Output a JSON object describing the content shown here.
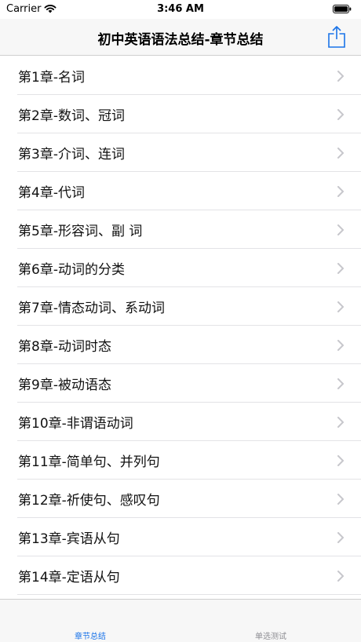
{
  "status_bar": {
    "carrier": "Carrier",
    "time": "3:46 AM",
    "wifi_icon": "wifi-icon",
    "battery_icon": "battery-icon"
  },
  "nav": {
    "title": "初中英语语法总结-章节总结",
    "share_icon": "share-icon"
  },
  "chapters": [
    "第1章-名词",
    "第2章-数词、冠词",
    "第3章-介词、连词",
    "第4章-代词",
    "第5章-形容词、副 词",
    "第6章-动词的分类",
    "第7章-情态动词、系动词",
    "第8章-动词时态",
    "第9章-被动语态",
    "第10章-非谓语动词",
    "第11章-简单句、并列句",
    "第12章-祈使句、感叹句",
    "第13章-宾语从句",
    "第14章-定语从句"
  ],
  "tabs": [
    {
      "label": "章节总结",
      "active": true
    },
    {
      "label": "单选测试",
      "active": false
    }
  ],
  "colors": {
    "accent": "#1a73e8",
    "inactive": "#8e8e93",
    "chevron": "#c7c7cc"
  }
}
